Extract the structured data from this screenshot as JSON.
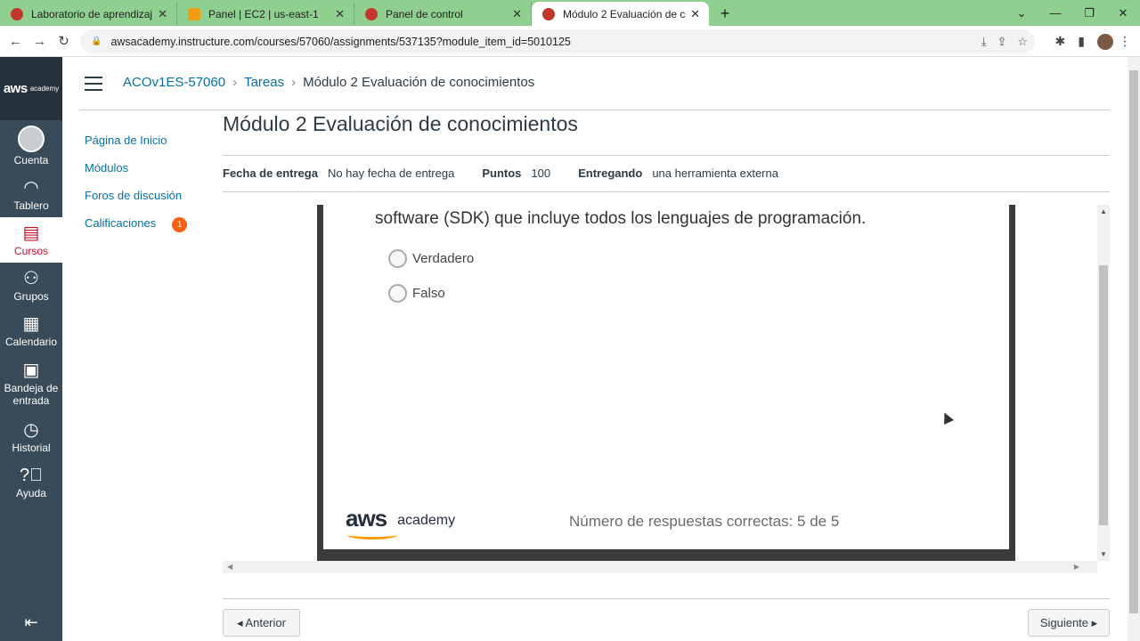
{
  "browser": {
    "tabs": [
      {
        "title": "Laboratorio de aprendizaje",
        "color": "#c0392b"
      },
      {
        "title": "Panel | EC2 | us-east-1",
        "color": "#f39c12"
      },
      {
        "title": "Panel de control",
        "color": "#c0392b"
      },
      {
        "title": "Módulo 2 Evaluación de conocim",
        "color": "#c0392b"
      }
    ],
    "url": "awsacademy.instructure.com/courses/57060/assignments/537135?module_item_id=5010125"
  },
  "global_nav": {
    "logo": {
      "brand": "aws",
      "sub": "academy"
    },
    "items": [
      {
        "label": "Cuenta",
        "icon": "account-icon"
      },
      {
        "label": "Tablero",
        "icon": "dashboard-icon"
      },
      {
        "label": "Cursos",
        "icon": "courses-icon"
      },
      {
        "label": "Grupos",
        "icon": "groups-icon"
      },
      {
        "label": "Calendario",
        "icon": "calendar-icon"
      },
      {
        "label": "Bandeja de entrada",
        "icon": "inbox-icon"
      },
      {
        "label": "Historial",
        "icon": "history-icon"
      },
      {
        "label": "Ayuda",
        "icon": "help-icon"
      }
    ]
  },
  "breadcrumb": {
    "course": "ACOv1ES-57060",
    "section": "Tareas",
    "current": "Módulo 2 Evaluación de conocimientos"
  },
  "course_nav": {
    "items": [
      "Página de Inicio",
      "Módulos",
      "Foros de discusión",
      "Calificaciones"
    ],
    "grades_badge": "1"
  },
  "assignment": {
    "title": "Módulo 2 Evaluación de conocimientos",
    "due_label": "Fecha de entrega",
    "due_value": "No hay fecha de entrega",
    "points_label": "Puntos",
    "points_value": "100",
    "submitting_label": "Entregando",
    "submitting_value": "una herramienta externa"
  },
  "quiz": {
    "question_fragment": "software (SDK) que incluye todos los lenguajes de programación.",
    "options": [
      "Verdadero",
      "Falso"
    ],
    "brand": "aws",
    "brand_sub": "academy",
    "score": "Número de respuestas correctas: 5 de 5"
  },
  "footer": {
    "prev": "◂ Anterior",
    "next": "Siguiente ▸"
  }
}
